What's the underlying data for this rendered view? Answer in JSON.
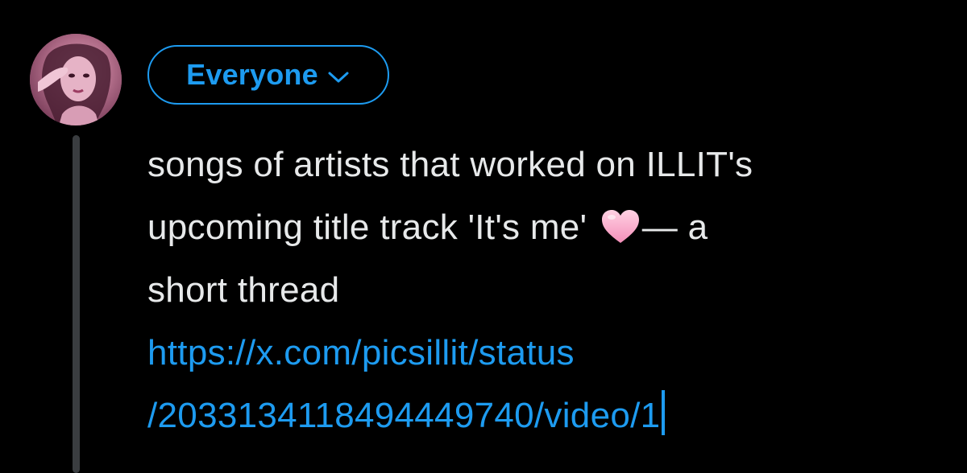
{
  "composer": {
    "audience_label": "Everyone",
    "audience_icon": "chevron-down-icon",
    "text_lines": {
      "line1": "songs of artists that worked on ILLIT's",
      "line2_before_emoji": "upcoming title track 'It's me' ",
      "line2_after_emoji": "— a",
      "line3": "short thread",
      "emoji": "pink-heart"
    },
    "link_lines": {
      "line1": "https://x.com/picsillit/status",
      "line2": "/2033134118494449740/video/1"
    }
  },
  "colors": {
    "background": "#000000",
    "accent": "#1d9bf0",
    "text": "#e7e9ea",
    "thread_line": "#3a3d40"
  }
}
